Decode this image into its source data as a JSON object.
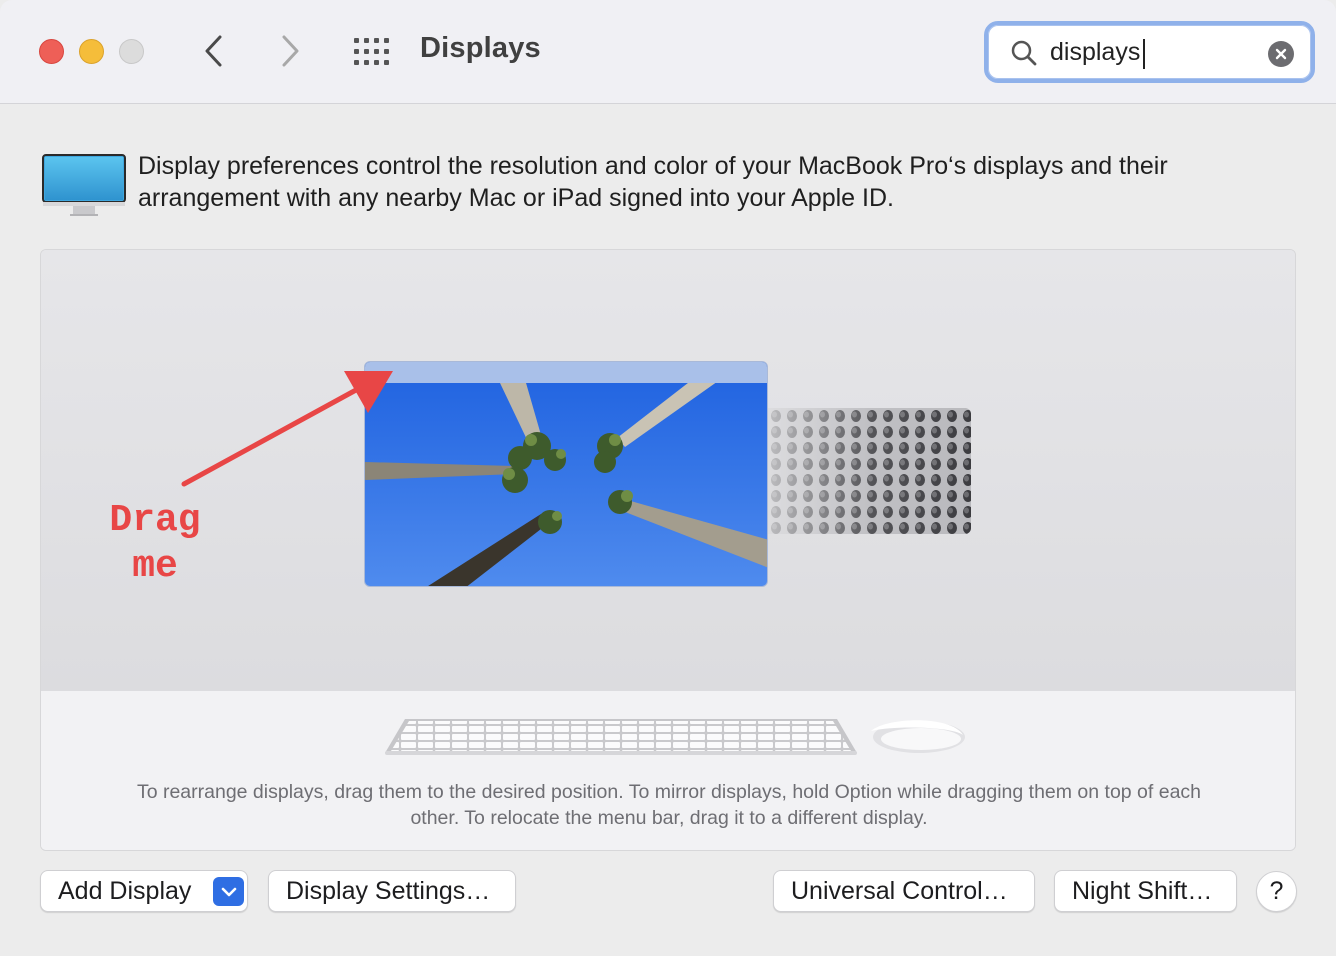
{
  "window": {
    "title": "Displays"
  },
  "toolbar": {
    "back_icon": "chevron-left-icon",
    "forward_icon": "chevron-right-icon",
    "show_all_icon": "grid-icon"
  },
  "search": {
    "value": "displays",
    "clear_icon": "clear-icon"
  },
  "intro": {
    "icon": "monitor-icon",
    "text": "Display preferences control the resolution and color of your MacBook Pro‘s displays and their arrangement with any nearby Mac or iPad signed into your Apple ID."
  },
  "arrangement": {
    "annotation_line1": "Drag",
    "annotation_line2": "me",
    "annotation_color": "#e84646",
    "hint": "To rearrange displays, drag them to the desired position. To mirror displays, hold Option while dragging them on top of each other. To relocate the menu bar, drag it to a different display."
  },
  "buttons": {
    "add_display": "Add Display",
    "display_settings": "Display Settings…",
    "universal_control": "Universal Control…",
    "night_shift": "Night Shift…",
    "help": "?"
  },
  "colors": {
    "accent": "#2f6ee3",
    "search_focus_ring": "#8fb1ea",
    "close": "#ee5f57",
    "minimize": "#f5bd3a"
  }
}
